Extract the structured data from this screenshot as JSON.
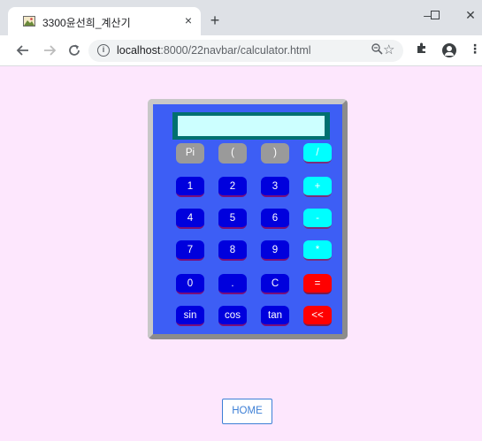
{
  "browser": {
    "tab_title": "3300윤선희_계산기",
    "tab_close": "×",
    "new_tab": "+",
    "window_min": "–",
    "window_max": "☐",
    "window_close": "✕",
    "url_host": "localhost",
    "url_path": ":8000/22navbar/calculator.html"
  },
  "calculator": {
    "display_value": "",
    "keys": [
      [
        "Pi",
        "(",
        ")",
        "/"
      ],
      [
        "1",
        "2",
        "3",
        "+"
      ],
      [
        "4",
        "5",
        "6",
        "-"
      ],
      [
        "7",
        "8",
        "9",
        "*"
      ],
      [
        "0",
        ".",
        "C",
        "="
      ],
      [
        "sin",
        "cos",
        "tan",
        "<<"
      ]
    ]
  },
  "home_label": "HOME",
  "colors": {
    "page_bg": "#fde7fd",
    "calc_body": "#3d5ef5",
    "display": "#ccffff",
    "number_key": "#0000dd",
    "operator_key": "#00ffff",
    "function_key": "#9a9a9a",
    "clear_key": "#ff0000",
    "home_accent": "#3d7fd6"
  }
}
